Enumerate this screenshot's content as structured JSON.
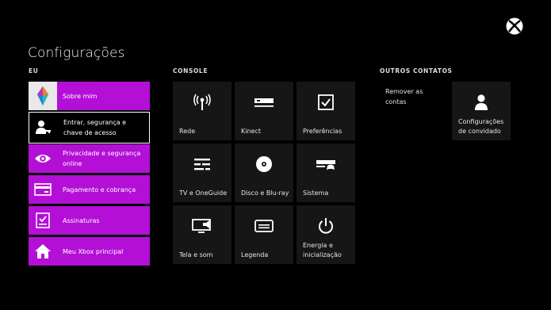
{
  "title": "Configurações",
  "sections": {
    "eu": "EU",
    "console": "CONSOLE",
    "outros": "OUTROS CONTATOS"
  },
  "eu_items": [
    {
      "label": "Sobre mim",
      "icon": "avatar-icon"
    },
    {
      "label": "Entrar, segurança e chave de acesso",
      "icon": "user-key-icon"
    },
    {
      "label": "Privacidade e segurança online",
      "icon": "eye-icon"
    },
    {
      "label": "Pagamento e cobrança",
      "icon": "credit-card-icon"
    },
    {
      "label": "Assinaturas",
      "icon": "checklist-icon"
    },
    {
      "label": "Meu Xbox principal",
      "icon": "home-icon"
    }
  ],
  "console_tiles": [
    {
      "label": "Rede",
      "icon": "network-icon"
    },
    {
      "label": "Kinect",
      "icon": "kinect-icon"
    },
    {
      "label": "Preferências",
      "icon": "checkbox-icon"
    },
    {
      "label": "TV e OneGuide",
      "icon": "tv-guide-icon"
    },
    {
      "label": "Disco e Blu-ray",
      "icon": "disc-icon"
    },
    {
      "label": "Sistema",
      "icon": "system-icon"
    },
    {
      "label": "Tela e som",
      "icon": "display-sound-icon"
    },
    {
      "label": "Legenda",
      "icon": "caption-icon"
    },
    {
      "label": "Energia e inicialização",
      "icon": "power-icon"
    }
  ],
  "outros": {
    "remover": "Remover as contas",
    "convidado": "Configurações de convidado"
  },
  "colors": {
    "accent": "#b40fd6",
    "tile": "#161616",
    "background": "#000000"
  }
}
